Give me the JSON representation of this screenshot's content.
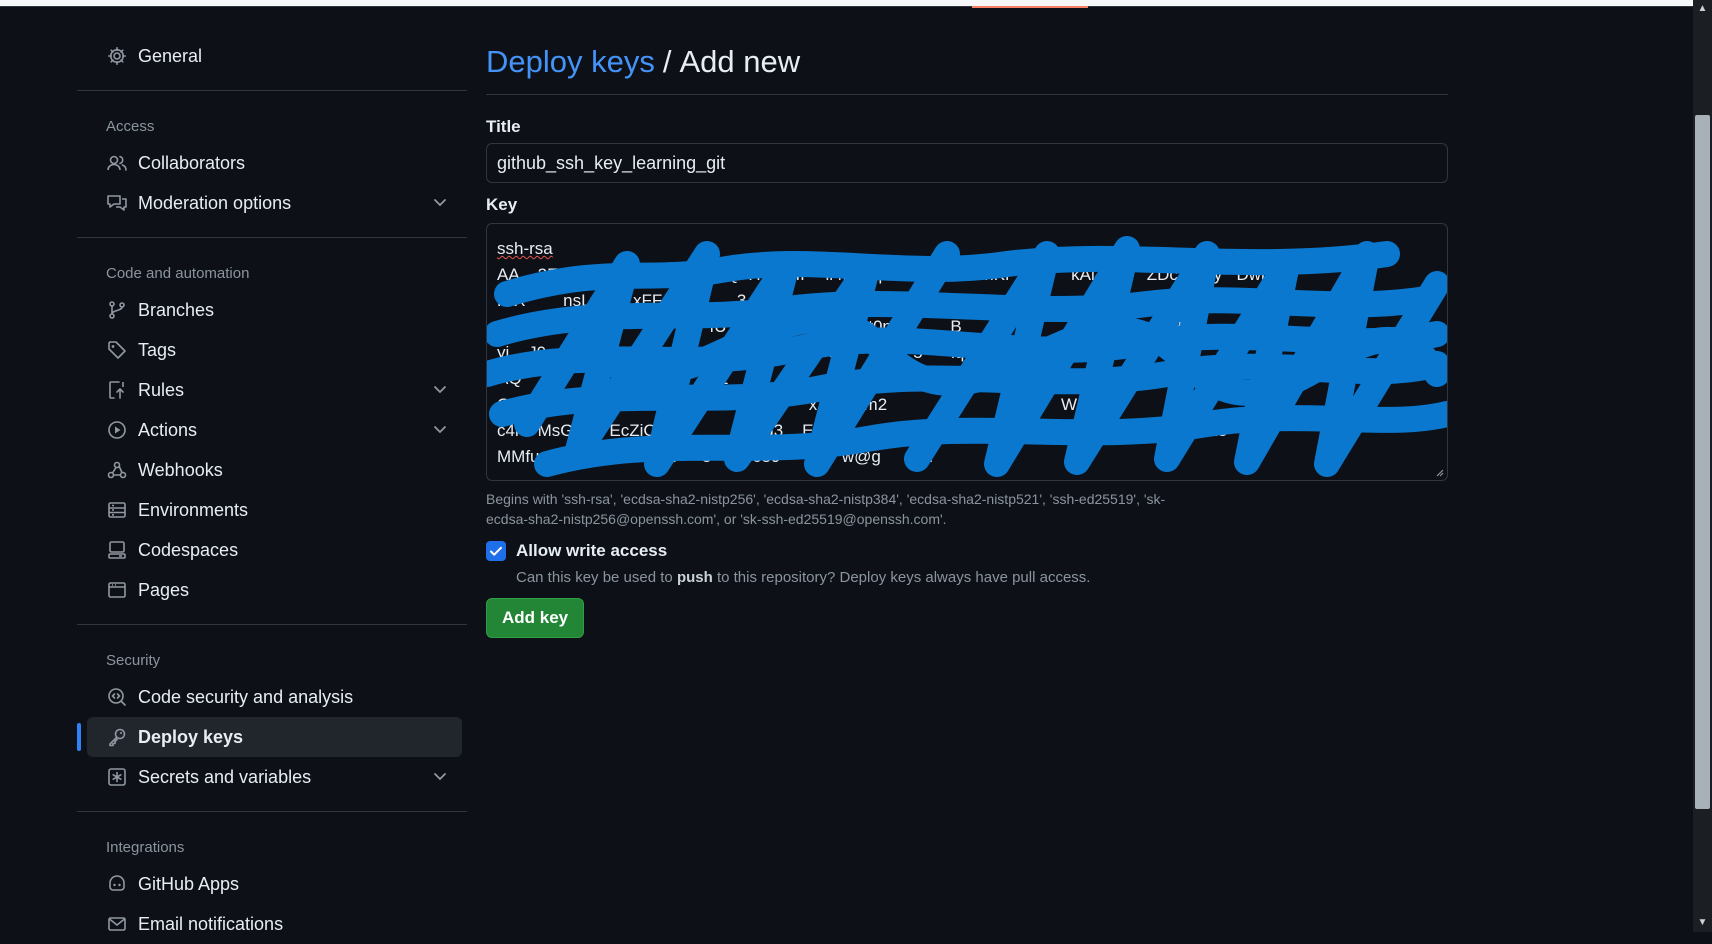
{
  "sidebar": {
    "general": "General",
    "access": {
      "heading": "Access",
      "items": [
        "Collaborators",
        "Moderation options"
      ]
    },
    "code_automation": {
      "heading": "Code and automation",
      "items": [
        "Branches",
        "Tags",
        "Rules",
        "Actions",
        "Webhooks",
        "Environments",
        "Codespaces",
        "Pages"
      ]
    },
    "security": {
      "heading": "Security",
      "items": [
        "Code security and analysis",
        "Deploy keys",
        "Secrets and variables"
      ]
    },
    "integrations": {
      "heading": "Integrations",
      "items": [
        "GitHub Apps",
        "Email notifications"
      ]
    }
  },
  "header": {
    "breadcrumb": "Deploy keys",
    "separator": "/",
    "title": "Add new"
  },
  "form": {
    "title_label": "Title",
    "title_value": "github_ssh_key_learning_git",
    "key_label": "Key",
    "key_first_line": "ssh-rsa",
    "key_visible_lines": [
      "AA    2EAAAA  QA   A    AQDVQ  H A5TfP   ll4N  JqN  8      4     nhKF   km    kAl4   a    ZDc  bzl y   DwpbG",
      "HIX        nsLt        xFF      x        3 RXe44   JS      X         8                                   3     Zwn0",
      "                                             fU 1                 M       t0nW         B      kG             pdl      Bj       8/",
      "yi    J0                 P                                W     6         t5    5      lq(  Kcf                                 Ly",
      "AQ                                        c2             Ju     7      8fi          a                                    B",
      "Q4qni              eC    LF    Or     AzN          x    8  cm2                           bj       W 5  kX          K    N        hcoD",
      "c4k   MsGID    EcZiC                       g3    E                  ZOE  ib5clb/O0J  B    DN/(     7W  WN1m18",
      "MMfurg9pqpcnKfJfQKt9     5    xtfi689             w@g         n"
    ],
    "key_hint": "Begins with 'ssh-rsa', 'ecdsa-sha2-nistp256', 'ecdsa-sha2-nistp384', 'ecdsa-sha2-nistp521', 'ssh-ed25519', 'sk-ecdsa-sha2-nistp256@openssh.com', or 'sk-ssh-ed25519@openssh.com'.",
    "write_access_label": "Allow write access",
    "write_access_checked": true,
    "write_note_pre": "Can this key be used to ",
    "write_note_bold": "push",
    "write_note_post": " to this repository? Deploy keys always have pull access.",
    "submit_label": "Add key"
  },
  "colors": {
    "background": "#0d1117",
    "accent": "#2f81f7",
    "button": "#238636",
    "redaction": "#0b78d0"
  }
}
